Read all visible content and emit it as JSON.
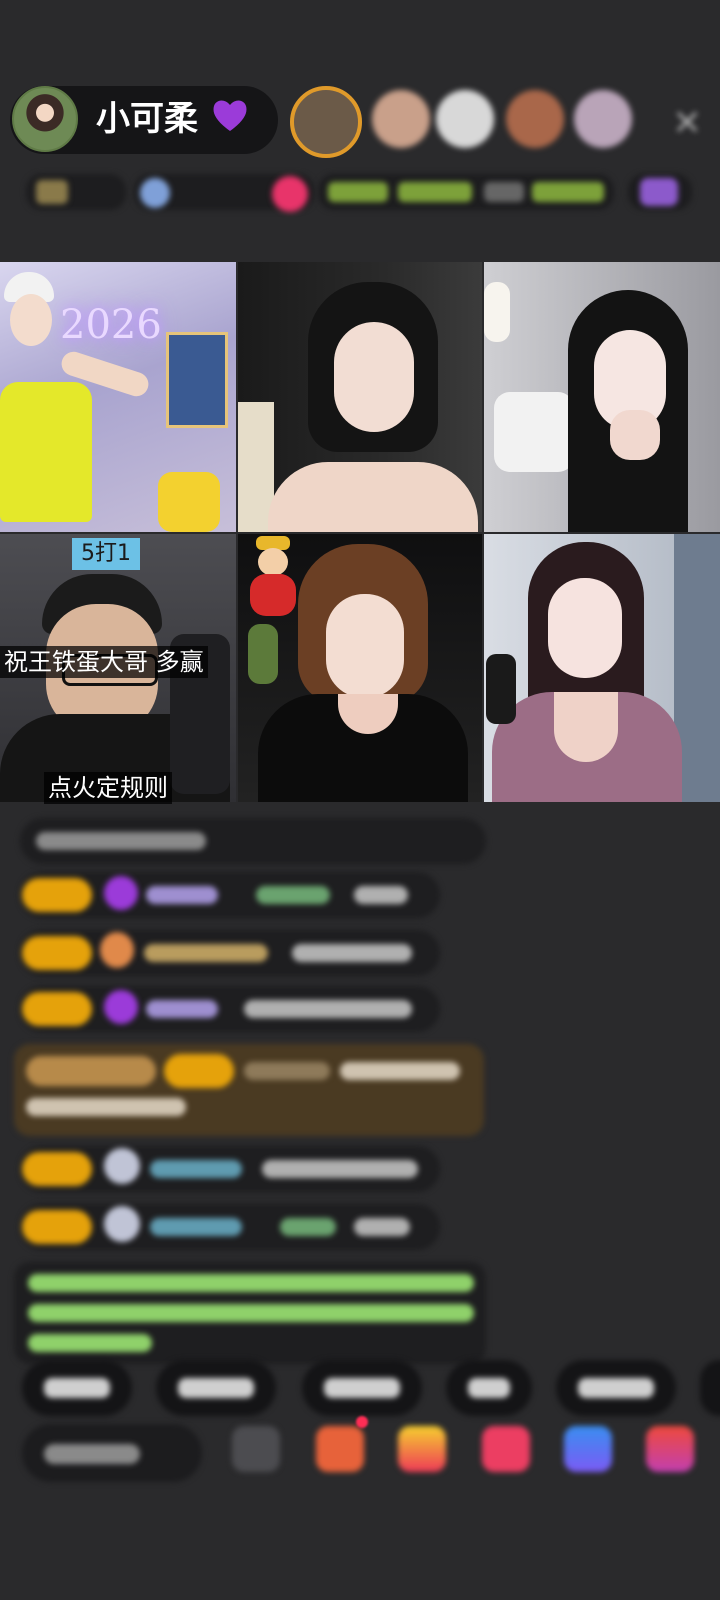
{
  "header": {
    "host_name": "小可柔",
    "host_emoji": "💜",
    "close_icon": "×"
  },
  "grid": {
    "tiles": [
      {
        "id": "tile-1",
        "neon_text": "2026"
      },
      {
        "id": "tile-2"
      },
      {
        "id": "tile-3"
      },
      {
        "id": "tile-4",
        "tag": "5打1",
        "caption_top": "祝王铁蛋大哥 多赢",
        "caption_bottom": "点火定规则"
      },
      {
        "id": "tile-5"
      },
      {
        "id": "tile-6"
      }
    ]
  },
  "icons": {
    "heart": "purple-heart-icon",
    "gift": "gift-icon",
    "share": "share-icon"
  },
  "colors": {
    "background": "#2a2a2c",
    "badge_gold": "#e5a20b",
    "chat_green": "#8fd16a",
    "accent_pink": "#ff3b6f"
  }
}
